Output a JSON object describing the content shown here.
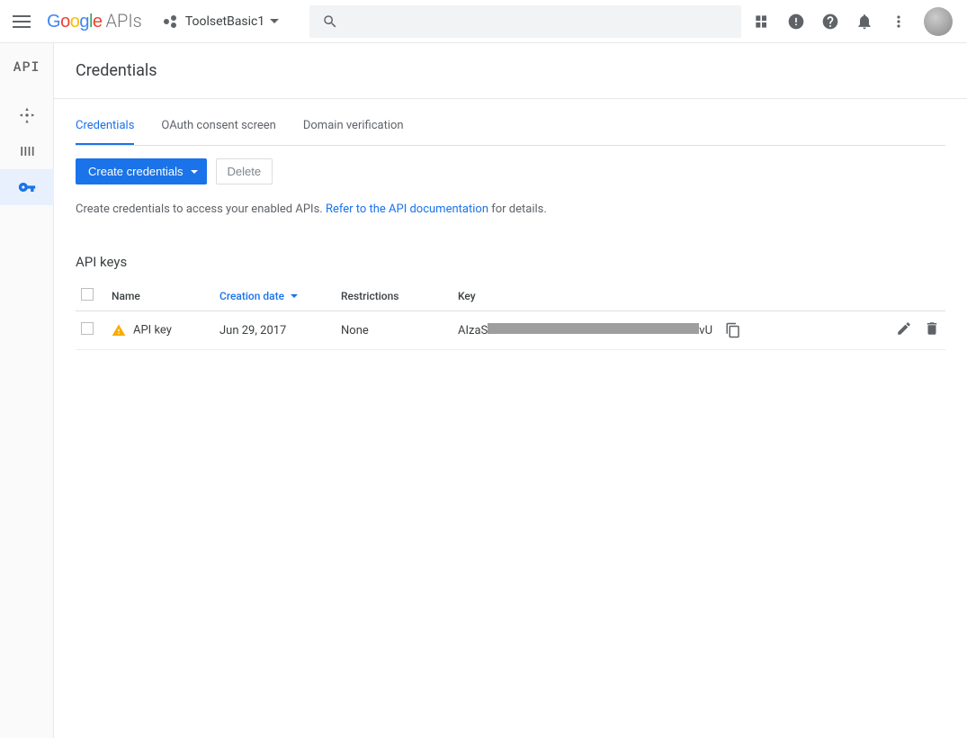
{
  "header": {
    "logo_suffix": "APIs",
    "project_name": "ToolsetBasic1",
    "search_placeholder": ""
  },
  "rail": {
    "label": "API"
  },
  "page": {
    "title": "Credentials"
  },
  "tabs": {
    "credentials": "Credentials",
    "oauth": "OAuth consent screen",
    "domain": "Domain verification"
  },
  "actions": {
    "create": "Create credentials",
    "delete": "Delete"
  },
  "help": {
    "prefix": "Create credentials to access your enabled APIs. ",
    "link": "Refer to the API documentation",
    "suffix": " for details."
  },
  "section": {
    "api_keys_title": "API keys"
  },
  "table": {
    "headers": {
      "name": "Name",
      "creation_date": "Creation date",
      "restrictions": "Restrictions",
      "key": "Key"
    },
    "row": {
      "name": "API key",
      "date": "Jun 29, 2017",
      "restrictions": "None",
      "key_prefix": "AIzaS",
      "key_suffix": "vU"
    }
  }
}
